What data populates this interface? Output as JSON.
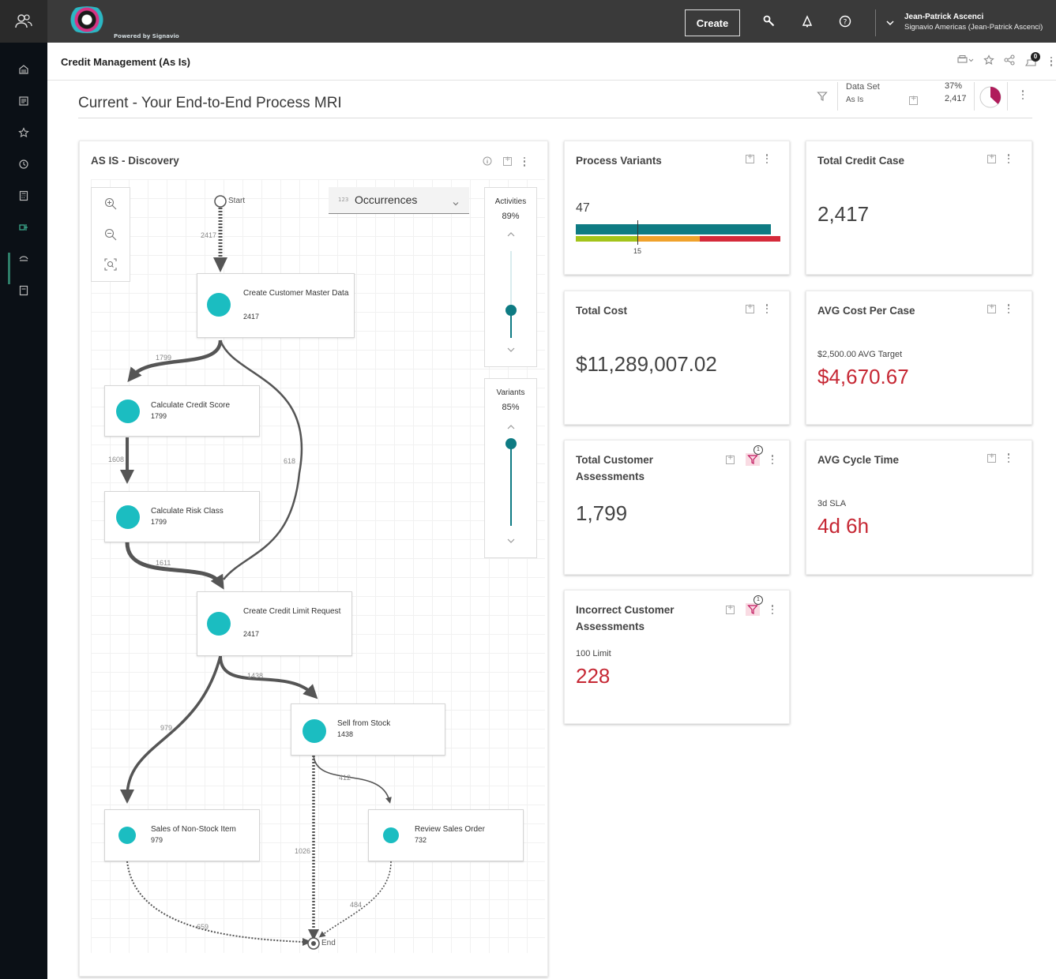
{
  "topbar": {
    "logo_caption": "Powered by Signavio",
    "create_label": "Create",
    "user_name": "Jean-Patrick Ascenci",
    "user_org": "Signavio Americas (Jean-Patrick Ascenci)"
  },
  "breadcrumb": {
    "title": "Credit Management (As Is)",
    "notification_count": "0"
  },
  "page": {
    "title": "Current - Your End-to-End Process MRI",
    "dataset_label": "Data Set",
    "dataset_name": "As Is",
    "dataset_pct": "37%",
    "dataset_count": "2,417",
    "dataset_fraction": 0.37
  },
  "discovery": {
    "title": "AS IS - Discovery",
    "metric_select": "Occurrences",
    "activities_label": "Activities",
    "activities_pct": "89%",
    "variants_label": "Variants",
    "variants_pct": "85%",
    "start_label": "Start",
    "end_label": "End",
    "nodes": [
      {
        "name": "Create Customer Master Data",
        "count": "2417"
      },
      {
        "name": "Calculate Credit Score",
        "count": "1799"
      },
      {
        "name": "Calculate Risk Class",
        "count": "1799"
      },
      {
        "name": "Create Credit Limit Request",
        "count": "2417"
      },
      {
        "name": "Sell from Stock",
        "count": "1438"
      },
      {
        "name": "Sales of Non-Stock Item",
        "count": "979"
      },
      {
        "name": "Review Sales Order",
        "count": "732"
      }
    ],
    "edges": {
      "start_to_master": "2417",
      "master_to_score": "1799",
      "score_to_risk": "1608",
      "master_to_limit": "618",
      "risk_to_limit": "1611",
      "limit_to_stock": "1438",
      "limit_to_nonstock": "979",
      "stock_to_review": "412",
      "stock_to_end": "1026",
      "nonstock_to_end": "659",
      "review_to_end": "484"
    }
  },
  "cards": {
    "variants": {
      "title": "Process Variants",
      "value": "47",
      "marker": "15"
    },
    "total_credit": {
      "title": "Total Credit Case",
      "value": "2,417"
    },
    "total_cost": {
      "title": "Total Cost",
      "value": "$11,289,007.02"
    },
    "avg_cost": {
      "title": "AVG Cost Per Case",
      "target": "$2,500.00 AVG Target",
      "value": "$4,670.67"
    },
    "assessments": {
      "title": "Total Customer Assessments",
      "value": "1,799",
      "filter_count": "1"
    },
    "cycle": {
      "title": "AVG Cycle Time",
      "target": "3d SLA",
      "value": "4d 6h"
    },
    "incorrect": {
      "title": "Incorrect Customer Assessments",
      "target": "100 Limit",
      "value": "228",
      "filter_count": "1"
    }
  },
  "colors": {
    "teal": "#1bbdc1",
    "bar_primary": "#0e7b83",
    "bar_green": "#a3c41a",
    "bar_orange": "#f0a22c",
    "bar_red": "#d52a3a",
    "alert_red": "#c62834"
  }
}
